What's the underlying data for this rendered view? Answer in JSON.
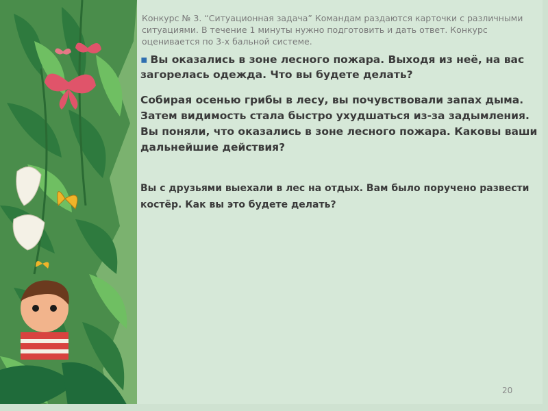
{
  "slide": {
    "header": "Конкурс № 3. “Ситуационная задача” Командам раздаются карточки с различными ситуациями. В течение 1 минуты нужно подготовить и дать ответ. Конкурс оценивается по 3-х бальной системе.",
    "question_1": "Вы оказались в зоне лесного пожара. Выходя из неё, на вас загорелась одежда. Что вы будете делать?",
    "question_2": "Собирая осенью грибы в лесу, вы почувствовали запах дыма. Затем видимость стала быстро ухудшаться из-за задымления. Вы поняли, что оказались в зоне лесного пожара. Каковы ваши дальнейшие действия?",
    "question_3": "Вы с друзьями выехали в лес на отдых. Вам было поручено развести костёр. Как вы это будете делать?",
    "bullet": "▪",
    "page_number": "20"
  },
  "colors": {
    "background": "#d6e8d8",
    "leaf_dark": "#1f6b3a",
    "leaf_light": "#4fa45a",
    "butterfly": "#e0546a",
    "butterfly_yellow": "#f0b429"
  }
}
